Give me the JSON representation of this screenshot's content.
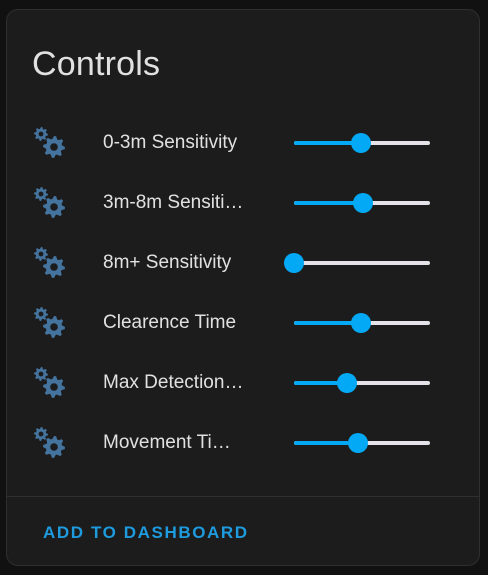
{
  "card": {
    "title": "Controls",
    "footer_button": "ADD TO DASHBOARD"
  },
  "colors": {
    "accent": "#03a9f4",
    "icon": "#44739e",
    "track": "#e6e2ea",
    "text": "#e1e1e1",
    "button_text": "#1e9bdf"
  },
  "rows": [
    {
      "label": "0-3m Sensitivity",
      "icon": "cog-multiple-icon",
      "value_fraction": 0.49
    },
    {
      "label": "3m-8m Sensiti…",
      "icon": "cog-multiple-icon",
      "value_fraction": 0.51
    },
    {
      "label": "8m+ Sensitivity",
      "icon": "cog-multiple-icon",
      "value_fraction": 0.0
    },
    {
      "label": "Clearence Time",
      "icon": "cog-multiple-icon",
      "value_fraction": 0.49
    },
    {
      "label": "Max Detection…",
      "icon": "cog-multiple-icon",
      "value_fraction": 0.39
    },
    {
      "label": "Movement Ti…",
      "icon": "cog-multiple-icon",
      "value_fraction": 0.47
    }
  ]
}
